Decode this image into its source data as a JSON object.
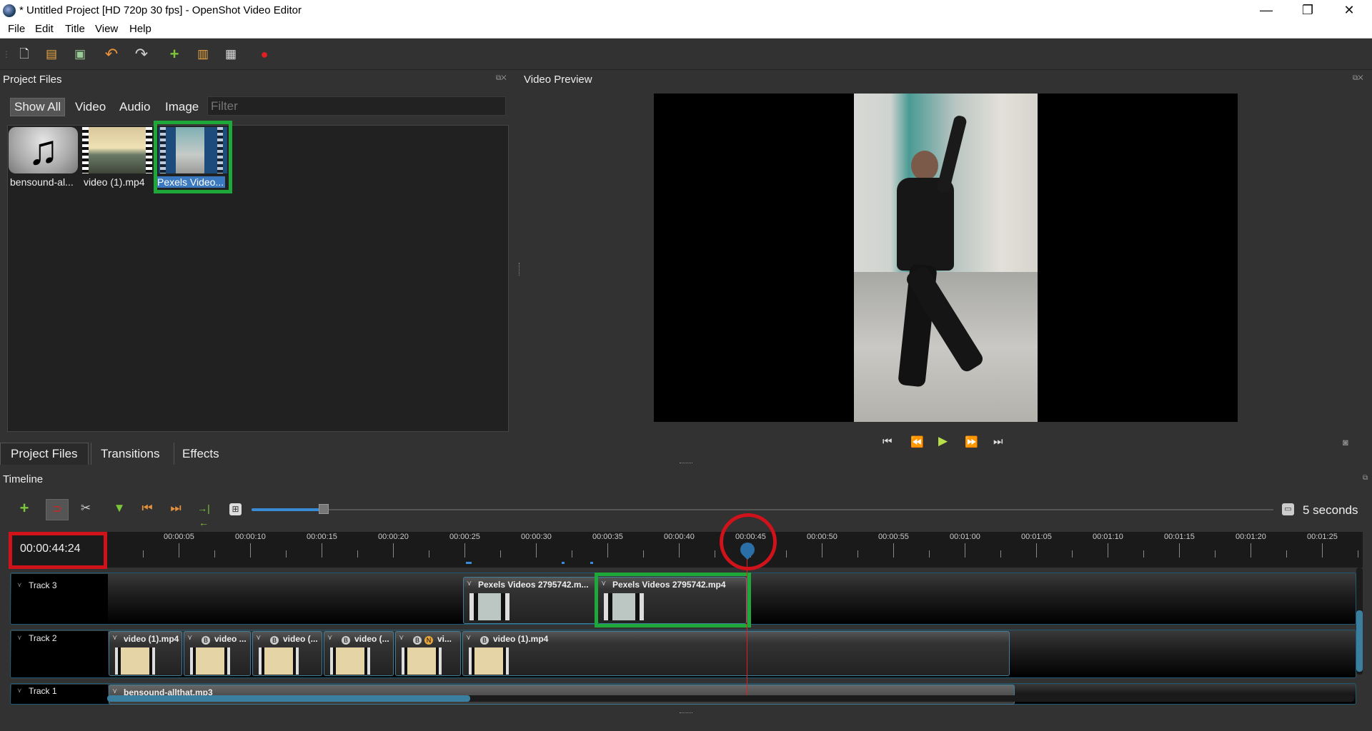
{
  "window": {
    "title": "* Untitled Project [HD 720p 30 fps] - OpenShot Video Editor",
    "minimize": "—",
    "restore": "❐",
    "close": "✕"
  },
  "menu": [
    "File",
    "Edit",
    "Title",
    "View",
    "Help"
  ],
  "toolbar": {
    "icons": [
      "new-file-icon",
      "open-folder-icon",
      "save-icon",
      "undo-icon",
      "redo-icon",
      "import-files-icon",
      "profile-icon",
      "fullscreen-icon",
      "record-icon"
    ]
  },
  "project_files": {
    "header": "Project Files",
    "tabs": [
      "Show All",
      "Video",
      "Audio",
      "Image"
    ],
    "filter_placeholder": "Filter",
    "files": [
      {
        "label": "bensound-al...",
        "type": "audio"
      },
      {
        "label": "video (1).mp4",
        "type": "video"
      },
      {
        "label": "Pexels Video...",
        "type": "video",
        "selected": true
      }
    ]
  },
  "bottom_tabs": [
    "Project Files",
    "Transitions",
    "Effects"
  ],
  "preview": {
    "header": "Video Preview"
  },
  "timeline": {
    "header": "Timeline",
    "zoom_label": "5 seconds",
    "timecode": "00:00:44:24",
    "ruler_labels": [
      "00:00:05",
      "00:00:10",
      "00:00:15",
      "00:00:20",
      "00:00:25",
      "00:00:30",
      "00:00:35",
      "00:00:40",
      "00:00:45",
      "00:00:50",
      "00:00:55",
      "00:01:00",
      "00:01:05",
      "00:01:10",
      "00:01:15",
      "00:01:20",
      "00:01:25"
    ],
    "tracks": [
      {
        "name": "Track 3",
        "clips": [
          {
            "label": "Pexels Videos 2795742.m...",
            "kind": "pexels"
          },
          {
            "label": "Pexels Videos 2795742.mp4",
            "kind": "pexels",
            "highlighted": true
          }
        ]
      },
      {
        "name": "Track 2",
        "clips": [
          {
            "label": "video (1).mp4",
            "kind": "video"
          },
          {
            "label": "video ...",
            "kind": "video",
            "badges": [
              "B"
            ]
          },
          {
            "label": "video (...",
            "kind": "video",
            "badges": [
              "B"
            ]
          },
          {
            "label": "video (...",
            "kind": "video",
            "badges": [
              "B"
            ]
          },
          {
            "label": "vi...",
            "kind": "video",
            "badges": [
              "B",
              "N"
            ]
          },
          {
            "label": "video (1).mp4",
            "kind": "video",
            "badges": [
              "B"
            ]
          }
        ]
      },
      {
        "name": "Track 1",
        "clips": [
          {
            "label": "bensound-allthat.mp3",
            "kind": "audio"
          }
        ]
      }
    ]
  },
  "colors": {
    "accent": "#3a8bd6",
    "highlight_green": "#1fa83a",
    "annotation_red": "#d0121b",
    "playhead": "#e02020"
  }
}
